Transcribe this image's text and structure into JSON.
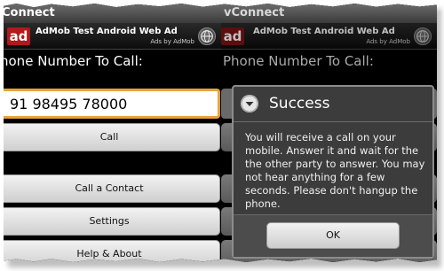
{
  "left_screen": {
    "app_title": "Connect",
    "ad": {
      "logo_text": "ad",
      "title": "AdMob Test Android Web Ad",
      "subtitle": "Ads by AdMob"
    },
    "phone_label": "hone Number To Call:",
    "phone_value": "91 98495 78000",
    "call_button": "Call",
    "call_contact_button": "Call a Contact",
    "settings_button": "Settings",
    "help_button": "Help & About"
  },
  "right_screen": {
    "app_title": "vConnect",
    "ad": {
      "logo_text": "ad",
      "title": "AdMob Test Android Web Ad",
      "subtitle": "Ads by AdMob"
    },
    "phone_label": "Phone Number To Call:",
    "dialog": {
      "title": "Success",
      "message": "You will receive a call on your mobile. Answer it and wait for the the other party to answer. You may not hear anything for a few seconds. Please don't hangup the phone.",
      "ok_button": "OK"
    }
  },
  "colors": {
    "input_focus": "#e8a33a",
    "ad_logo": "#b01a1a",
    "dialog_bg": "#3c3c3c"
  }
}
